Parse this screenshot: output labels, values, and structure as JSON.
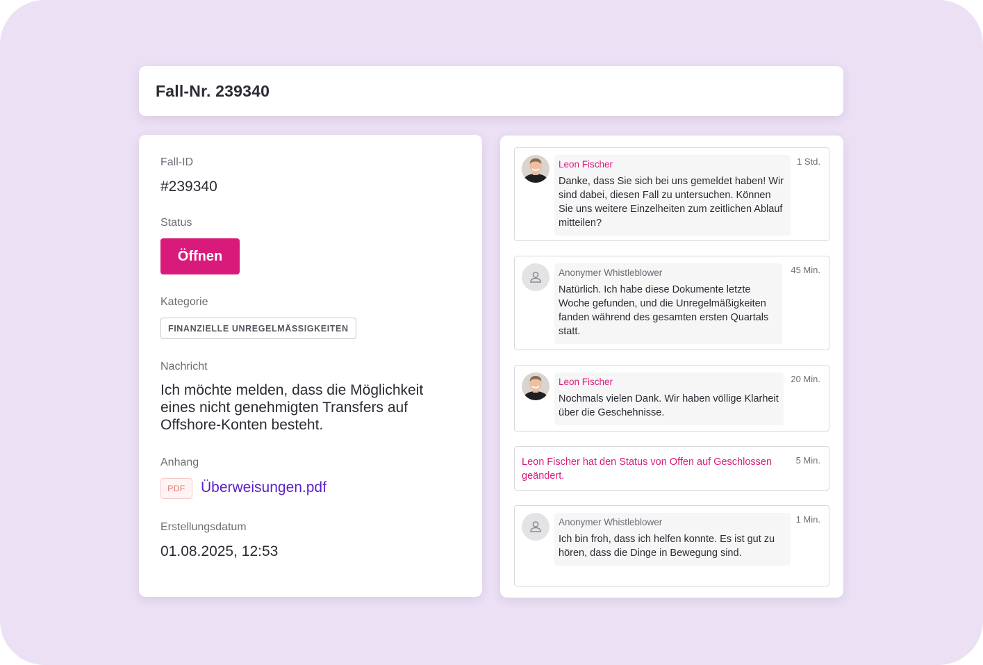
{
  "header": {
    "title": "Fall-Nr. 239340"
  },
  "details": {
    "case_id_label": "Fall-ID",
    "case_id": "#239340",
    "status_label": "Status",
    "status_button": "Öffnen",
    "category_label": "Kategorie",
    "category": "FINANZIELLE UNREGELMÄSSIGKEITEN",
    "message_label": "Nachricht",
    "message": "Ich möchte melden, dass die Möglichkeit eines nicht genehmigten Transfers auf Offshore-Konten besteht.",
    "attachment_label": "Anhang",
    "attachment_type": "PDF",
    "attachment_name": "Überweisungen.pdf",
    "created_label": "Erstellungsdatum",
    "created": "01.08.2025, 12:53"
  },
  "thread": [
    {
      "sender": "Leon Fischer",
      "text": "Danke, dass Sie sich bei uns gemeldet haben! Wir sind dabei, diesen Fall zu untersuchen. Können Sie uns weitere Einzelheiten zum zeitlichen Ablauf mitteilen?",
      "time": "1 Std."
    },
    {
      "sender": "Anonymer Whistleblower",
      "text": "Natürlich. Ich habe diese Dokumente letzte Woche gefunden, und die Unregelmäßigkeiten fanden während des gesamten ersten Quartals statt.",
      "time": "45 Min."
    },
    {
      "sender": "Leon Fischer",
      "text": "Nochmals vielen Dank. Wir haben völlige Klarheit über die Geschehnisse.",
      "time": "20 Min."
    },
    {
      "system": "Leon Fischer hat den Status von Offen auf Geschlossen geändert.",
      "time": "5 Min."
    },
    {
      "sender": "Anonymer Whistleblower",
      "text": "Ich bin froh, dass ich helfen konnte. Es ist gut zu hören, dass die Dinge in Bewegung sind.",
      "time": "1 Min."
    }
  ],
  "colors": {
    "accent": "#d81b7b",
    "link": "#5b1fc9",
    "background": "#ebe0f4"
  },
  "icons": {
    "anonymous_avatar": "user-silhouette-icon",
    "leon_avatar": "avatar-photo"
  }
}
